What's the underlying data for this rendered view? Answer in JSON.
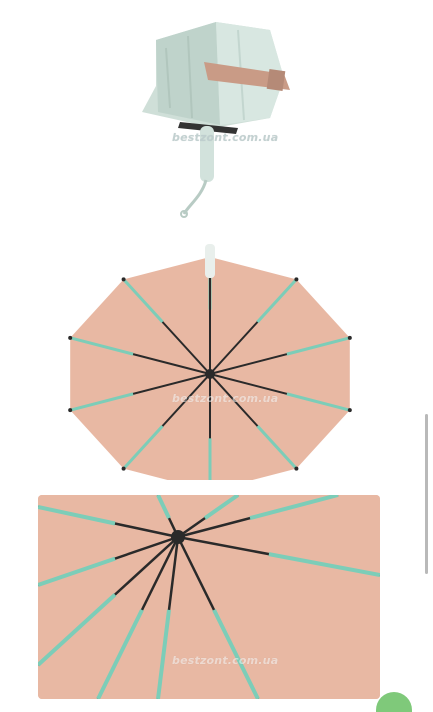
{
  "gallery": {
    "images": [
      {
        "alt": "Folded mint umbrella with pink strap",
        "watermark": "bestzont.com.ua"
      },
      {
        "alt": "Open umbrella inside view, peach canopy with mint ribs",
        "watermark": "bestzont.com.ua"
      },
      {
        "alt": "Close-up of umbrella frame with mint ribs",
        "watermark": "bestzont.com.ua"
      }
    ]
  },
  "colors": {
    "canopy": "#e8b8a3",
    "ribs": "#7ccdb8",
    "folded_body": "#cfdfd8",
    "strap": "#c99b86",
    "frame": "#2a2a2a"
  }
}
